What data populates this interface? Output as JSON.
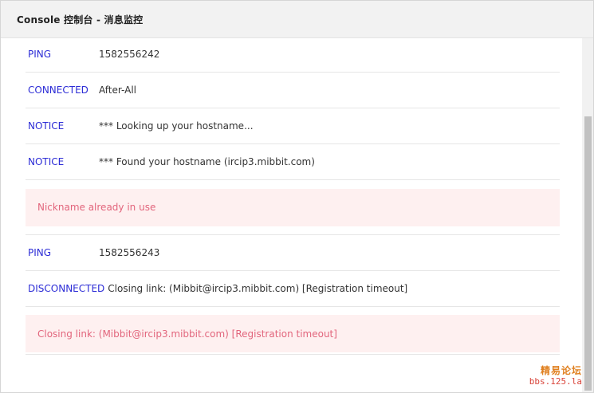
{
  "window": {
    "title": "Console 控制台 - 消息监控"
  },
  "log": {
    "rows": [
      {
        "type": "PING",
        "message": "1582556242"
      },
      {
        "type": "CONNECTED",
        "message": "After-All"
      },
      {
        "type": "NOTICE",
        "message": "*** Looking up your hostname..."
      },
      {
        "type": "NOTICE",
        "message": "*** Found your hostname (ircip3.mibbit.com)"
      },
      {
        "alert": "Nickname already in use"
      },
      {
        "type": "PING",
        "message": "1582556243"
      },
      {
        "type": "DISCONNECTED",
        "message": "Closing link: (Mibbit@ircip3.mibbit.com) [Registration timeout]"
      },
      {
        "alert": "Closing link: (Mibbit@ircip3.mibbit.com) [Registration timeout]"
      }
    ]
  },
  "watermark": {
    "line1": "精易论坛",
    "line2": "bbs.125.la"
  },
  "colors": {
    "type_label": "#2c2cd6",
    "alert_text": "#e2657c",
    "alert_background": "#fef0f0",
    "titlebar_background": "#f2f2f2"
  }
}
